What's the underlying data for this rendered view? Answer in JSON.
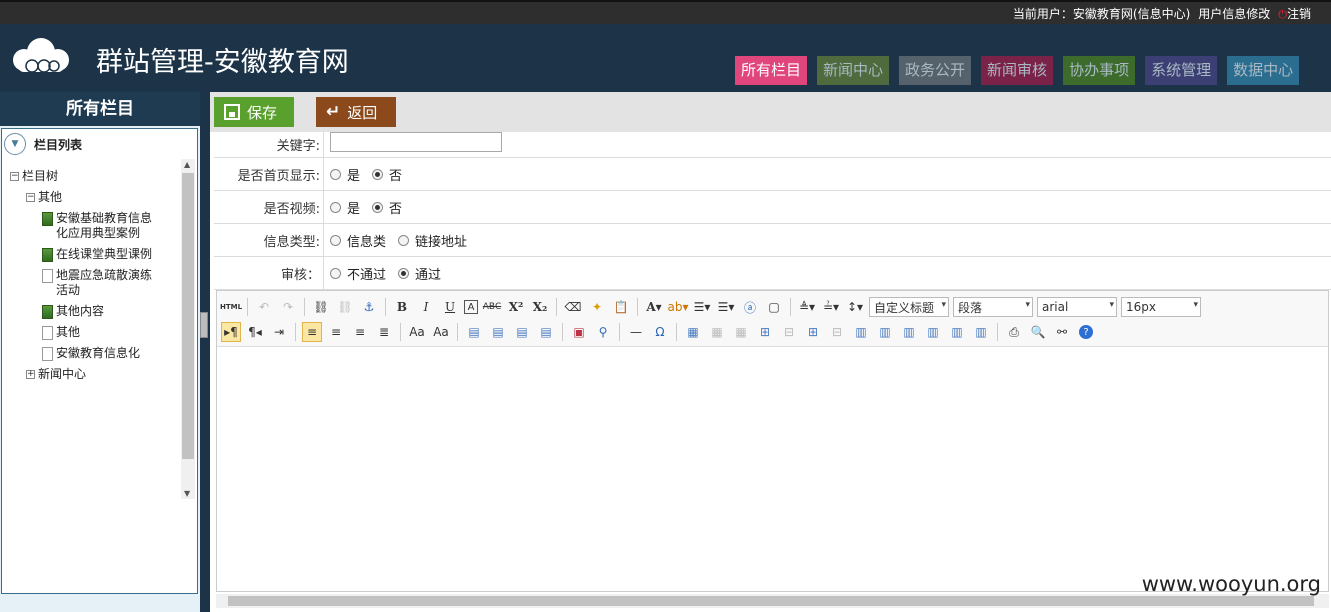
{
  "topbar": {
    "current_user": "当前用户：安徽教育网(信息中心)",
    "profile_link": "用户信息修改",
    "logout_link": "注销"
  },
  "header": {
    "site_title": "群站管理-安徽教育网",
    "nav_tabs": [
      {
        "label": "所有栏目",
        "color": "#e0457c"
      },
      {
        "label": "新闻中心",
        "color": "#4f6a3d"
      },
      {
        "label": "政务公开",
        "color": "#56626b"
      },
      {
        "label": "新闻审核",
        "color": "#7a2247"
      },
      {
        "label": "协办事项",
        "color": "#3c6b2c"
      },
      {
        "label": "系统管理",
        "color": "#3c3f73"
      },
      {
        "label": "数据中心",
        "color": "#2b6d8f"
      }
    ]
  },
  "sidebar": {
    "title": "所有栏目",
    "tree_title": "栏目列表",
    "tree": {
      "root": "栏目树",
      "other": "其他",
      "items": [
        "安徽基础教育信息化应用典型案例",
        "在线课堂典型课例",
        "地震应急疏散演练活动",
        "其他内容",
        "其他",
        "安徽教育信息化"
      ],
      "news": "新闻中心"
    }
  },
  "toolbar": {
    "save_label": "保存",
    "back_label": "返回"
  },
  "form": {
    "keyword_label": "关键字:",
    "homepage_label": "是否首页显示:",
    "video_label": "是否视频:",
    "type_label": "信息类型:",
    "audit_label": "审核：",
    "yes": "是",
    "no": "否",
    "type_info": "信息类",
    "type_link": "链接地址",
    "audit_reject": "不通过",
    "audit_pass": "通过"
  },
  "editor": {
    "html_btn": "HTML",
    "title_select": "自定义标题",
    "para_select": "段落",
    "font_select": "arial",
    "size_select": "16px"
  },
  "watermark": "www.wooyun.org"
}
